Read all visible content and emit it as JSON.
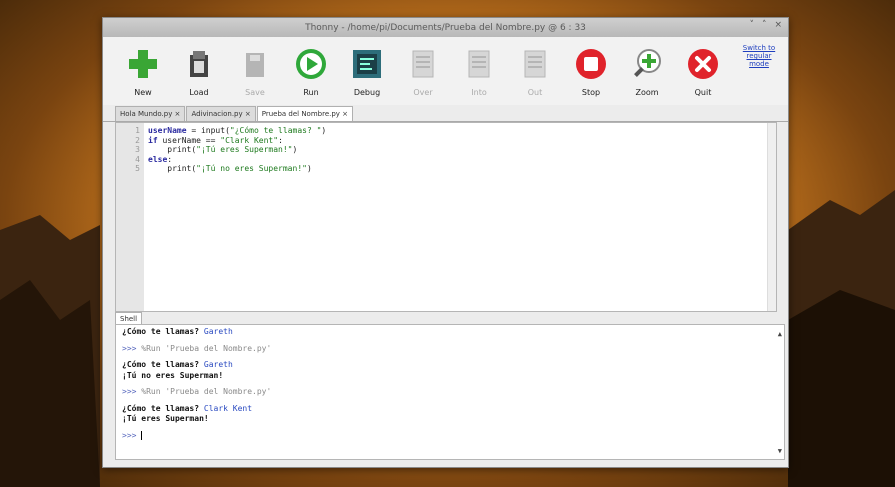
{
  "window": {
    "title": "Thonny  -  /home/pi/Documents/Prueba del Nombre.py  @  6 : 33",
    "controls": [
      "˅",
      "˄",
      "×"
    ]
  },
  "toolbar": {
    "buttons": [
      {
        "label": "New",
        "icon": "new-icon",
        "enabled": true,
        "color": "#3aa635"
      },
      {
        "label": "Load",
        "icon": "load-icon",
        "enabled": true,
        "color": "#333333"
      },
      {
        "label": "Save",
        "icon": "save-icon",
        "enabled": false,
        "color": "#b5b5b5"
      },
      {
        "label": "Run",
        "icon": "run-icon",
        "enabled": true,
        "color": "#2fa83a"
      },
      {
        "label": "Debug",
        "icon": "debug-icon",
        "enabled": true,
        "color": "#2d6d7a"
      },
      {
        "label": "Over",
        "icon": "step-over-icon",
        "enabled": false,
        "color": "#b5b5b5"
      },
      {
        "label": "Into",
        "icon": "step-into-icon",
        "enabled": false,
        "color": "#b5b5b5"
      },
      {
        "label": "Out",
        "icon": "step-out-icon",
        "enabled": false,
        "color": "#b5b5b5"
      },
      {
        "label": "Stop",
        "icon": "stop-icon",
        "enabled": true,
        "color": "#e0232b"
      },
      {
        "label": "Zoom",
        "icon": "zoom-icon",
        "enabled": true,
        "color": "#3aa635"
      },
      {
        "label": "Quit",
        "icon": "quit-icon",
        "enabled": true,
        "color": "#e0232b"
      }
    ],
    "switch_mode": "Switch to regular mode"
  },
  "tabs": [
    {
      "label": "Hola Mundo.py ×",
      "active": false
    },
    {
      "label": "Adivinacion.py ×",
      "active": false
    },
    {
      "label": "Prueba del Nombre.py ×",
      "active": true
    }
  ],
  "editor": {
    "line_numbers": [
      "1",
      "2",
      "3",
      "4",
      "5"
    ],
    "lines": [
      "userName = input(\"¿Cómo te llamas? \")",
      "if userName == \"Clark Kent\":",
      "    print(\"¡Tú eres Superman!\")",
      "else:",
      "    print(\"¡Tú no eres Superman!\")"
    ]
  },
  "shell": {
    "tab_label": "Shell",
    "lines": [
      {
        "type": "mixed",
        "parts": [
          {
            "cls": "out",
            "text": "¿Cómo te llamas? "
          },
          {
            "cls": "input",
            "text": "Gareth"
          }
        ]
      },
      {
        "type": "blank"
      },
      {
        "type": "mixed",
        "parts": [
          {
            "cls": "prompt",
            "text": ">>> "
          },
          {
            "cls": "cmd",
            "text": "%Run 'Prueba del Nombre.py'"
          }
        ]
      },
      {
        "type": "blank"
      },
      {
        "type": "mixed",
        "parts": [
          {
            "cls": "out",
            "text": "¿Cómo te llamas? "
          },
          {
            "cls": "input",
            "text": "Gareth"
          }
        ]
      },
      {
        "type": "mixed",
        "parts": [
          {
            "cls": "out",
            "text": "¡Tú no eres Superman!"
          }
        ]
      },
      {
        "type": "blank"
      },
      {
        "type": "mixed",
        "parts": [
          {
            "cls": "prompt",
            "text": ">>> "
          },
          {
            "cls": "cmd",
            "text": "%Run 'Prueba del Nombre.py'"
          }
        ]
      },
      {
        "type": "blank"
      },
      {
        "type": "mixed",
        "parts": [
          {
            "cls": "out",
            "text": "¿Cómo te llamas? "
          },
          {
            "cls": "input",
            "text": "Clark Kent"
          }
        ]
      },
      {
        "type": "mixed",
        "parts": [
          {
            "cls": "out",
            "text": "¡Tú eres Superman!"
          }
        ]
      },
      {
        "type": "blank"
      },
      {
        "type": "mixed",
        "parts": [
          {
            "cls": "prompt",
            "text": ">>> "
          }
        ]
      }
    ]
  }
}
